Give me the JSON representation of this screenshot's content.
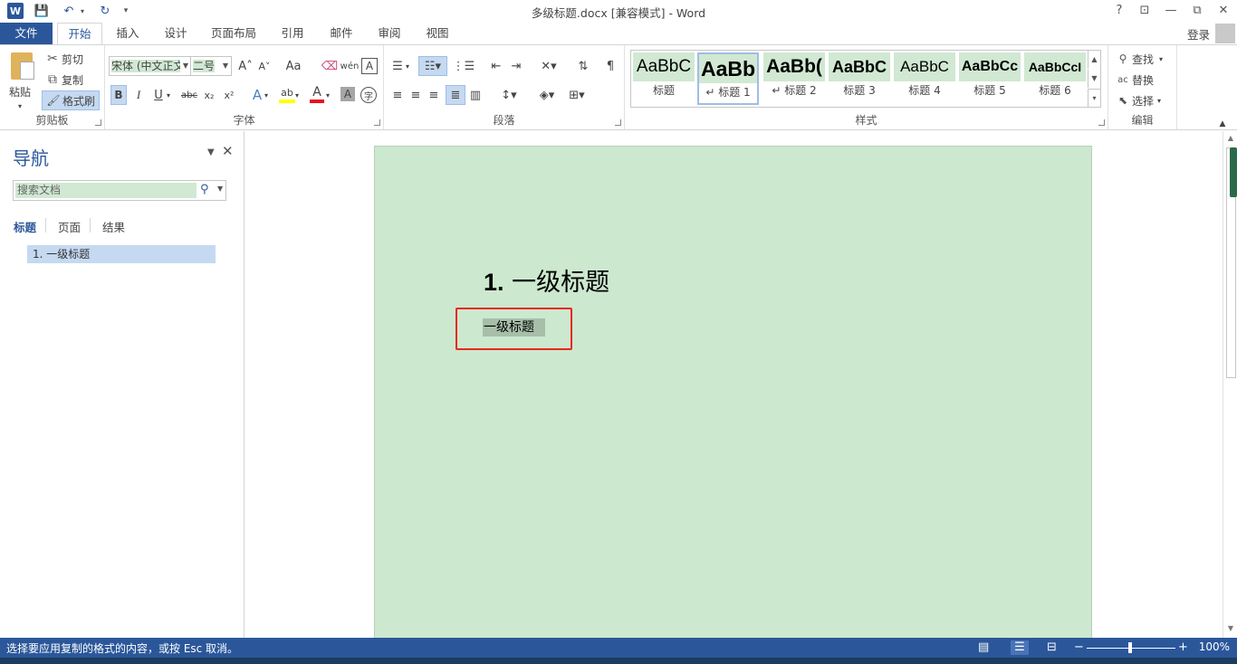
{
  "window": {
    "title": "多级标题.docx [兼容模式] - Word",
    "help": "?",
    "ribbon_display": "⊡",
    "minimize": "—",
    "restore": "⧉",
    "close": "✕"
  },
  "quick_access": {
    "app_icon": "W",
    "save": "💾",
    "undo": "↶",
    "redo": "↻",
    "customize": "▾"
  },
  "tabs": [
    "文件",
    "开始",
    "插入",
    "设计",
    "页面布局",
    "引用",
    "邮件",
    "审阅",
    "视图"
  ],
  "active_tab": "开始",
  "login": "登录",
  "clipboard": {
    "paste": "粘贴",
    "cut": "剪切",
    "copy": "复制",
    "format_painter": "格式刷",
    "group": "剪贴板"
  },
  "font": {
    "name": "宋体 (中文正文",
    "size": "二号",
    "grow": "A˄",
    "shrink": "A˅",
    "change_case": "Aa",
    "clear": "A⌫",
    "phonetic": "wén",
    "border": "A",
    "bold": "B",
    "italic": "I",
    "underline": "U",
    "strike": "abc",
    "subscript": "x₂",
    "superscript": "x²",
    "effects": "A",
    "highlight": "ab",
    "color": "A",
    "shading": "A",
    "enclose": "字",
    "group": "字体"
  },
  "paragraph": {
    "group": "段落"
  },
  "styles": {
    "items": [
      {
        "sample": "AaBbC",
        "name": "标题"
      },
      {
        "sample": "AaBb",
        "name": "↵ 标题 1"
      },
      {
        "sample": "AaBb(",
        "name": "↵ 标题 2"
      },
      {
        "sample": "AaBbC",
        "name": "标题 3"
      },
      {
        "sample": "AaBbC",
        "name": "标题 4"
      },
      {
        "sample": "AaBbCc",
        "name": "标题 5"
      },
      {
        "sample": "AaBbCcI",
        "name": "标题 6"
      }
    ],
    "group": "样式"
  },
  "editing": {
    "find": "查找",
    "replace": "替换",
    "select": "选择",
    "group": "编辑"
  },
  "navigation": {
    "title": "导航",
    "search_placeholder": "搜索文档",
    "tabs": [
      "标题",
      "页面",
      "结果"
    ],
    "active_tab": "标题",
    "items": [
      "1. 一级标题"
    ]
  },
  "document": {
    "heading_number": "1.",
    "heading_text": "一级标题",
    "body_text": "一级标题"
  },
  "statusbar": {
    "message": "选择要应用复制的格式的内容，或按 Esc 取消。",
    "zoom": "100%",
    "zoom_minus": "−",
    "zoom_plus": "+"
  }
}
